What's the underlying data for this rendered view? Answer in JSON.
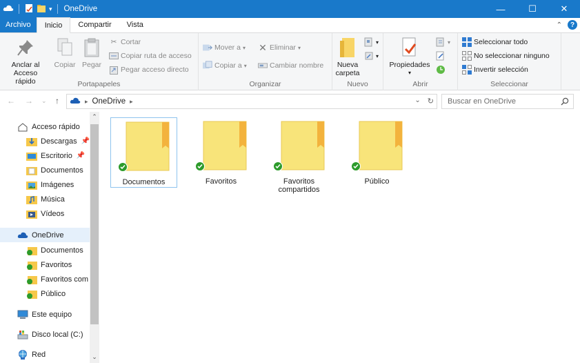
{
  "window": {
    "title": "OneDrive"
  },
  "tabs": {
    "file": "Archivo",
    "home": "Inicio",
    "share": "Compartir",
    "view": "Vista"
  },
  "ribbon": {
    "clipboard": {
      "label": "Portapapeles",
      "pin": "Anclar al\nAcceso rápido",
      "copy": "Copiar",
      "paste": "Pegar",
      "cut": "Cortar",
      "copy_path": "Copiar ruta de acceso",
      "paste_shortcut": "Pegar acceso directo"
    },
    "organize": {
      "label": "Organizar",
      "move_to": "Mover a",
      "copy_to": "Copiar a",
      "delete": "Eliminar",
      "rename": "Cambiar nombre"
    },
    "new": {
      "label": "Nuevo",
      "new_folder": "Nueva\ncarpeta"
    },
    "open": {
      "label": "Abrir",
      "properties": "Propiedades"
    },
    "select": {
      "label": "Seleccionar",
      "select_all": "Seleccionar todo",
      "select_none": "No seleccionar ninguno",
      "invert": "Invertir selección"
    }
  },
  "address": {
    "path": "OneDrive",
    "search_placeholder": "Buscar en OneDrive"
  },
  "nav": {
    "quick_access": "Acceso rápido",
    "quick_items": [
      "Descargas",
      "Escritorio",
      "Documentos",
      "Imágenes",
      "Música",
      "Vídeos"
    ],
    "onedrive": "OneDrive",
    "onedrive_items": [
      "Documentos",
      "Favoritos",
      "Favoritos com",
      "Público"
    ],
    "this_pc": "Este equipo",
    "local_disk": "Disco local (C:)",
    "network": "Red"
  },
  "folders": [
    {
      "name": "Documentos"
    },
    {
      "name": "Favoritos"
    },
    {
      "name": "Favoritos\ncompartidos"
    },
    {
      "name": "Público"
    }
  ],
  "colors": {
    "accent": "#1979ca",
    "folder": "#f8e47a",
    "folder_tab": "#f3b33d",
    "sync_ok": "#2d9b2b"
  }
}
